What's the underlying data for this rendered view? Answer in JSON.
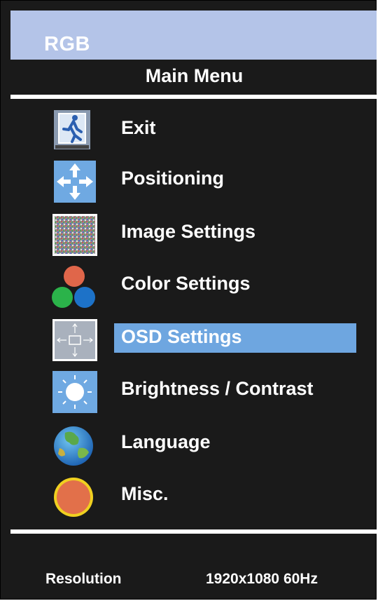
{
  "source": {
    "label": "RGB"
  },
  "menu": {
    "title": "Main Menu",
    "selected_index": 4,
    "items": [
      {
        "label": "Exit",
        "icon": "exit-icon"
      },
      {
        "label": "Positioning",
        "icon": "positioning-icon"
      },
      {
        "label": "Image Settings",
        "icon": "image-settings-icon"
      },
      {
        "label": "Color Settings",
        "icon": "color-settings-icon"
      },
      {
        "label": "OSD Settings",
        "icon": "osd-settings-icon"
      },
      {
        "label": "Brightness / Contrast",
        "icon": "brightness-icon"
      },
      {
        "label": "Language",
        "icon": "globe-icon"
      },
      {
        "label": "Misc.",
        "icon": "misc-icon"
      }
    ]
  },
  "status": {
    "resolution_label": "Resolution",
    "resolution_value": "1920x1080 60Hz"
  },
  "colors": {
    "header_bg": "#b4c4e8",
    "selection": "#6ea6e0",
    "panel_bg": "#1a1a1a"
  }
}
